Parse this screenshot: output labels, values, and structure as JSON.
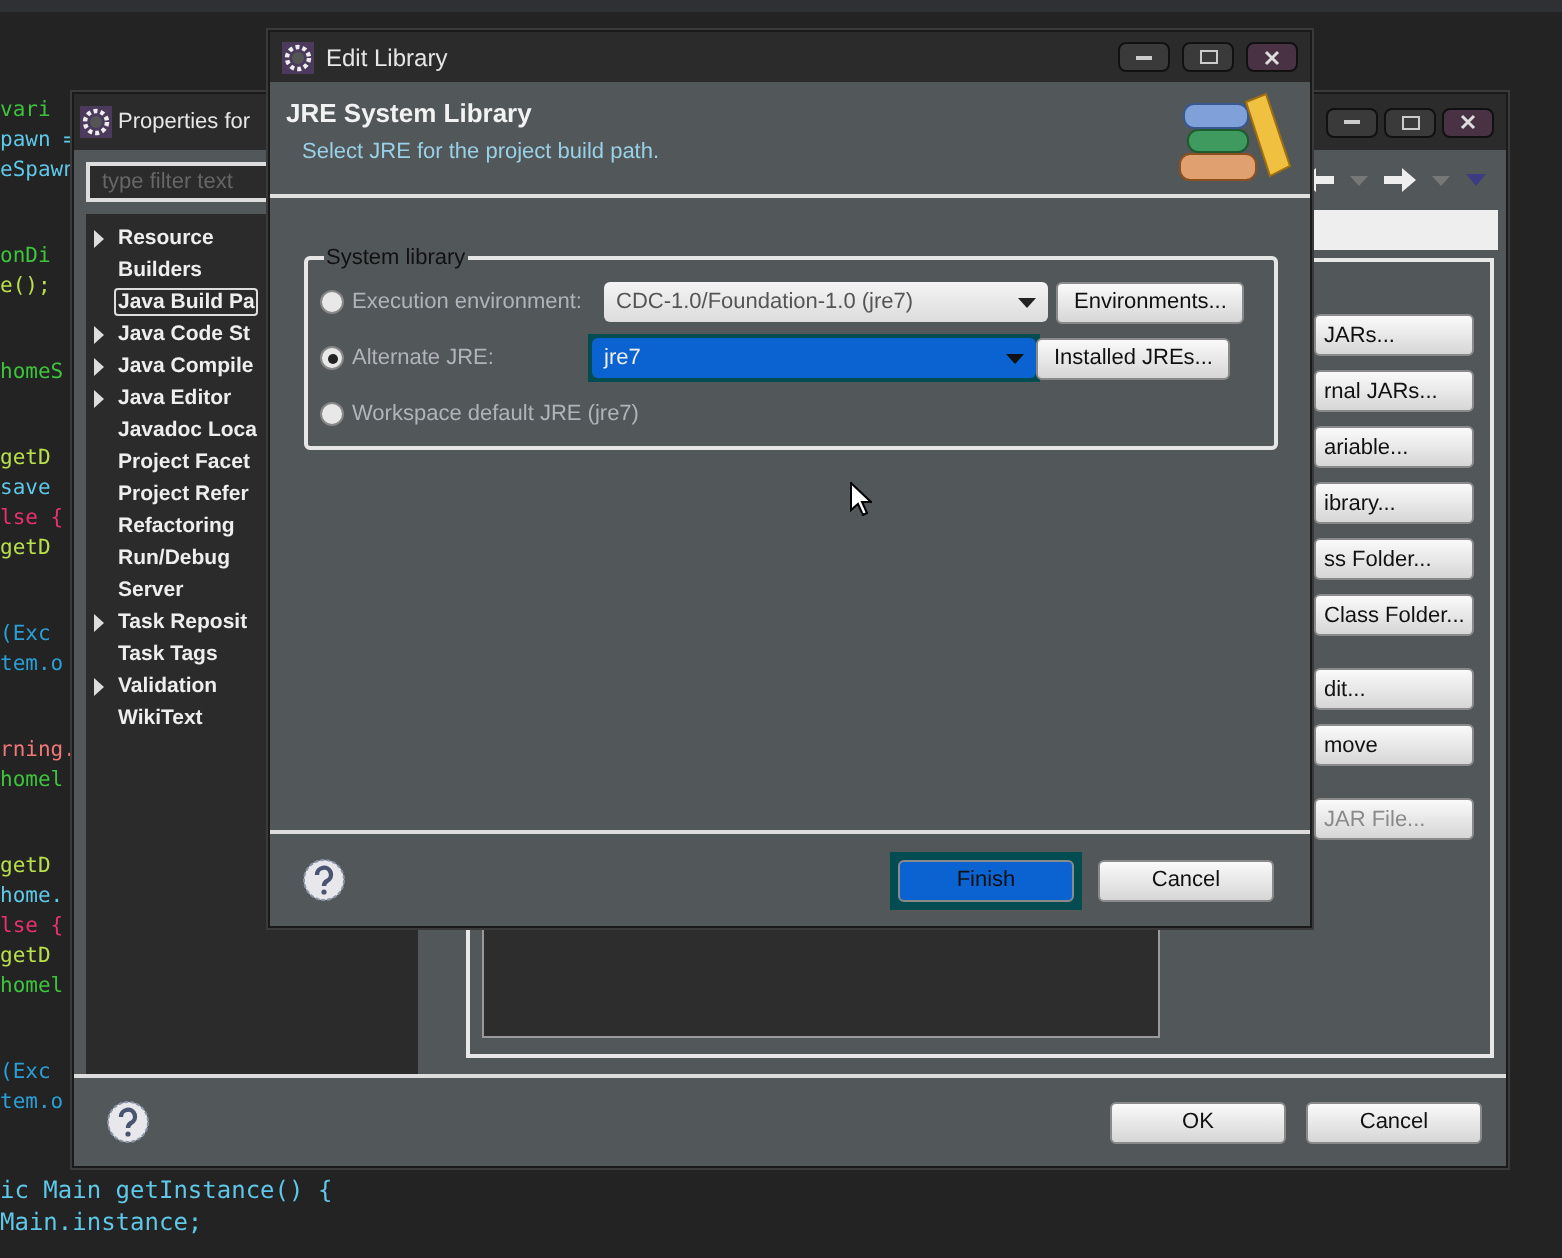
{
  "editor": {
    "blocks": [
      [
        {
          "text": "vari",
          "color": "#3dc43d"
        },
        {
          "text": "pawn =",
          "color": "#5fc8e8"
        },
        {
          "text": "eSpawn",
          "color": "#5fc8e8"
        }
      ],
      [
        {
          "text": "onDi",
          "color": "#3dc43d"
        },
        {
          "text": "e();",
          "color": "#b8e04a"
        }
      ],
      [
        {
          "text": "homeS",
          "color": "#3dc43d"
        }
      ],
      [
        {
          "text": "getD",
          "color": "#b8e04a"
        },
        {
          "text": "save",
          "color": "#5fc8e8"
        },
        {
          "text": "lse {",
          "color": "#e8316e"
        },
        {
          "text": "getD",
          "color": "#b8e04a"
        }
      ],
      [
        {
          "text": "(Exc",
          "color": "#2a9fd6"
        },
        {
          "text": "tem.o",
          "color": "#2a9fd6"
        }
      ],
      [
        {
          "text": "rning.",
          "color": "#f07878"
        },
        {
          "text": "homel",
          "color": "#3dc43d"
        }
      ],
      [
        {
          "text": "getD",
          "color": "#b8e04a"
        },
        {
          "text": "home.",
          "color": "#5fc8e8"
        },
        {
          "text": "lse {",
          "color": "#e8316e"
        },
        {
          "text": "getD",
          "color": "#b8e04a"
        },
        {
          "text": "homel",
          "color": "#3dc43d"
        }
      ],
      [
        {
          "text": "(Exc",
          "color": "#2a9fd6"
        },
        {
          "text": "tem.o",
          "color": "#2a9fd6"
        }
      ]
    ],
    "footer_lines": [
      "ic Main getInstance() {",
      "Main.instance;"
    ]
  },
  "properties_window": {
    "title": "Properties for",
    "filter": {
      "placeholder": "type filter text"
    },
    "tree": [
      {
        "label": "Resource",
        "expandable": true,
        "selected": false
      },
      {
        "label": "Builders",
        "expandable": false,
        "selected": false
      },
      {
        "label": "Java Build Pa",
        "expandable": false,
        "selected": true
      },
      {
        "label": "Java Code St",
        "expandable": true,
        "selected": false
      },
      {
        "label": "Java Compile",
        "expandable": true,
        "selected": false
      },
      {
        "label": "Java Editor",
        "expandable": true,
        "selected": false
      },
      {
        "label": "Javadoc Loca",
        "expandable": false,
        "selected": false
      },
      {
        "label": "Project Facet",
        "expandable": false,
        "selected": false
      },
      {
        "label": "Project Refer",
        "expandable": false,
        "selected": false
      },
      {
        "label": "Refactoring",
        "expandable": false,
        "selected": false
      },
      {
        "label": "Run/Debug",
        "expandable": false,
        "selected": false
      },
      {
        "label": "Server",
        "expandable": false,
        "selected": false
      },
      {
        "label": "Task Reposit",
        "expandable": true,
        "selected": false
      },
      {
        "label": "Task Tags",
        "expandable": false,
        "selected": false
      },
      {
        "label": "Validation",
        "expandable": true,
        "selected": false
      },
      {
        "label": "WikiText",
        "expandable": false,
        "selected": false
      }
    ],
    "side_button_groups": [
      [
        {
          "label": "JARs...",
          "disabled": false
        },
        {
          "label": "rnal JARs...",
          "disabled": false
        },
        {
          "label": "ariable...",
          "disabled": false
        },
        {
          "label": "ibrary...",
          "disabled": false
        },
        {
          "label": "ss Folder...",
          "disabled": false
        },
        {
          "label": "Class Folder...",
          "disabled": false
        }
      ],
      [
        {
          "label": "dit...",
          "disabled": false
        },
        {
          "label": "move",
          "disabled": false
        }
      ],
      [
        {
          "label": "JAR File...",
          "disabled": true
        }
      ]
    ],
    "buttons": [
      "OK",
      "Cancel"
    ]
  },
  "edit_library_dialog": {
    "title": "Edit Library",
    "heading": "JRE System Library",
    "subtitle": "Select JRE for the project build path.",
    "group_label": "System library",
    "options": [
      {
        "label": "Execution environment:",
        "selected": false,
        "kind": "combo",
        "value": "CDC-1.0/Foundation-1.0 (jre7)",
        "focused": false,
        "button": "Environments..."
      },
      {
        "label": "Alternate JRE:",
        "selected": true,
        "kind": "combo",
        "value": "jre7",
        "focused": true,
        "button": "Installed JREs..."
      },
      {
        "label": "Workspace default JRE (jre7)",
        "selected": false,
        "kind": "plain"
      }
    ],
    "buttons": [
      {
        "label": "Finish",
        "default": true
      },
      {
        "label": "Cancel",
        "default": false
      }
    ]
  }
}
